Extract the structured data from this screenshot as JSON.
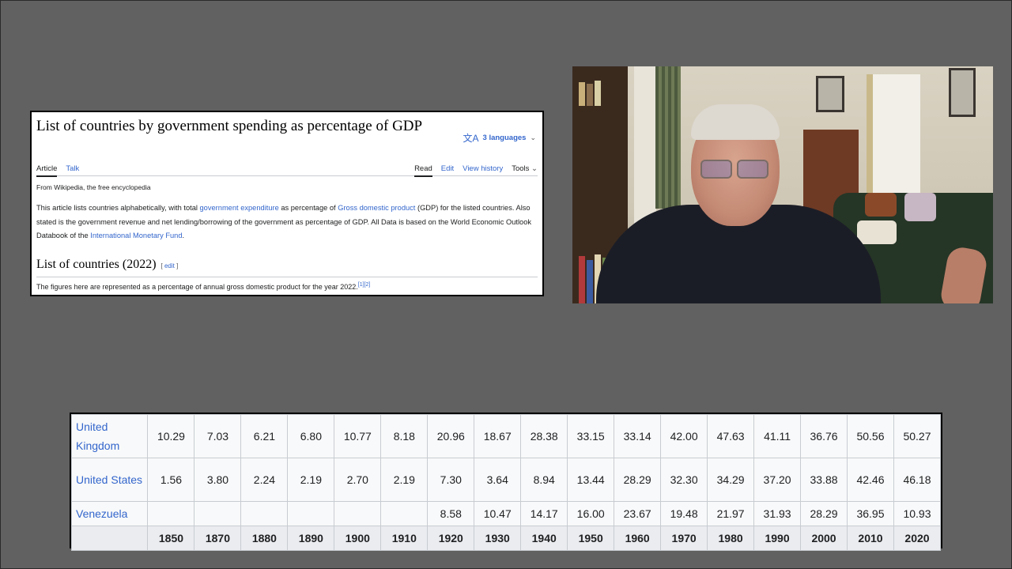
{
  "wiki": {
    "title": "List of countries by government spending as percentage of GDP",
    "languages": "3 languages",
    "tabs_left": [
      "Article",
      "Talk"
    ],
    "tabs_right": [
      "Read",
      "Edit",
      "View history",
      "Tools"
    ],
    "from": "From Wikipedia, the free encyclopedia",
    "para_1": "This article lists countries alphabetically, with total ",
    "link_1": "government expenditure",
    "para_2": " as percentage of ",
    "link_2": "Gross domestic product",
    "para_3": " (GDP) for the listed countries. Also stated is the government revenue and net lending/borrowing of the government as percentage of GDP. All Data is based on the World Economic Outlook Databook of the ",
    "link_3": "International Monetary Fund",
    "para_4": ".",
    "section_heading": "List of countries (2022)",
    "edit_label": "edit",
    "figures_note": "The figures here are represented as a percentage of annual gross domestic product for the year 2022.",
    "figures_ref": "[1][2]"
  },
  "table": {
    "rows": [
      {
        "country": "United Kingdom",
        "values": [
          "10.29",
          "7.03",
          "6.21",
          "6.80",
          "10.77",
          "8.18",
          "20.96",
          "18.67",
          "28.38",
          "33.15",
          "33.14",
          "42.00",
          "47.63",
          "41.11",
          "36.76",
          "50.56",
          "50.27"
        ]
      },
      {
        "country": "United States",
        "values": [
          "1.56",
          "3.80",
          "2.24",
          "2.19",
          "2.70",
          "2.19",
          "7.30",
          "3.64",
          "8.94",
          "13.44",
          "28.29",
          "32.30",
          "34.29",
          "37.20",
          "33.88",
          "42.46",
          "46.18"
        ]
      },
      {
        "country": "Venezuela",
        "values": [
          "",
          "",
          "",
          "",
          "",
          "",
          "8.58",
          "10.47",
          "14.17",
          "16.00",
          "23.67",
          "19.48",
          "21.97",
          "31.93",
          "28.29",
          "36.95",
          "10.93"
        ]
      }
    ],
    "years": [
      "1850",
      "1870",
      "1880",
      "1890",
      "1900",
      "1910",
      "1920",
      "1930",
      "1940",
      "1950",
      "1960",
      "1970",
      "1980",
      "1990",
      "2000",
      "2010",
      "2020"
    ]
  },
  "colors": {
    "background": "#616161",
    "link": "#3366cc",
    "text": "#202122"
  },
  "icons": {
    "translate": "translate-icon",
    "chevron": "chevron-down-icon"
  }
}
